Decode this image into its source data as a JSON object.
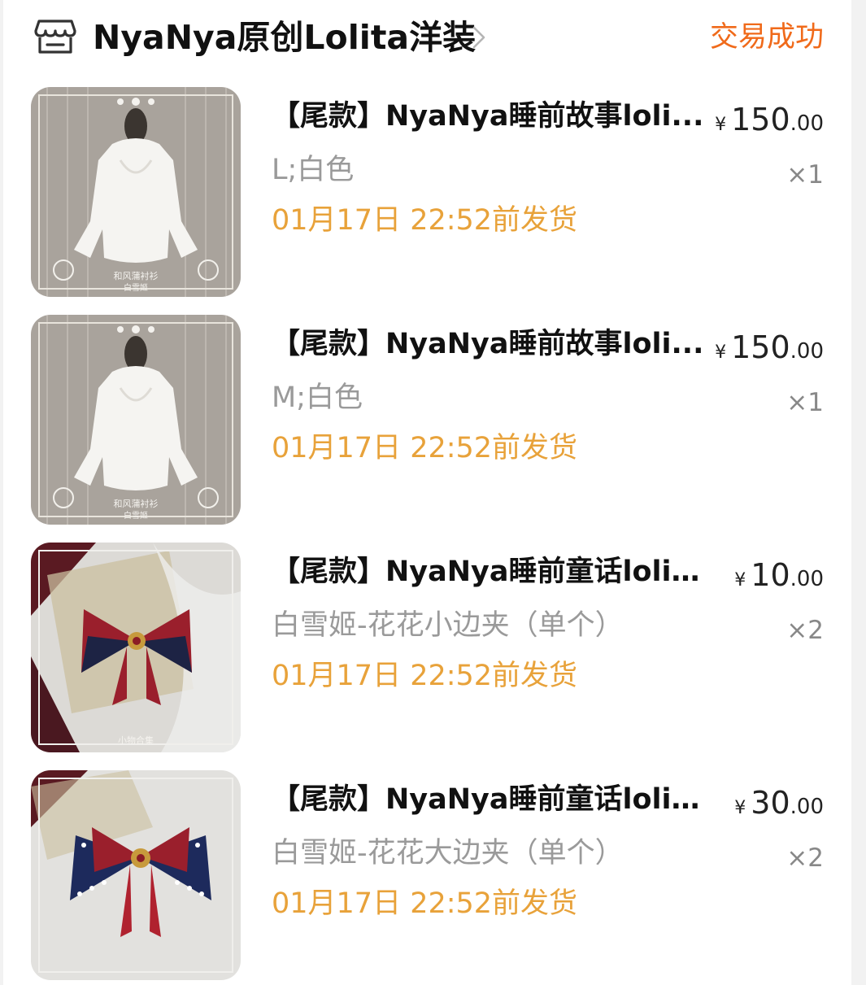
{
  "shop": {
    "name": "NyaNya原创Lolita洋装",
    "status": "交易成功",
    "icon": "shop-icon"
  },
  "colors": {
    "status": "#f06a1a",
    "ship": "#e8a23a",
    "sku": "#9a9a9a"
  },
  "items": [
    {
      "title": "【尾款】NyaNya睡前故事loli...",
      "price_currency": "¥",
      "price_int": "150",
      "price_dec": ".00",
      "sku": "L;白色",
      "qty": "×1",
      "ship": "01月17日 22:52前发货",
      "image_caption_1": "和风蒲衬衫",
      "image_caption_2": "白雪姬"
    },
    {
      "title": "【尾款】NyaNya睡前故事loli...",
      "price_currency": "¥",
      "price_int": "150",
      "price_dec": ".00",
      "sku": "M;白色",
      "qty": "×1",
      "ship": "01月17日 22:52前发货",
      "image_caption_1": "和风蒲衬衫",
      "image_caption_2": "白雪姬"
    },
    {
      "title": "【尾款】NyaNya睡前童话lolit...",
      "price_currency": "¥",
      "price_int": "10",
      "price_dec": ".00",
      "sku": "白雪姬-花花小边夹（单个）",
      "qty": "×2",
      "ship": "01月17日 22:52前发货",
      "image_caption_1": "小物合集"
    },
    {
      "title": "【尾款】NyaNya睡前童话lolit...",
      "price_currency": "¥",
      "price_int": "30",
      "price_dec": ".00",
      "sku": "白雪姬-花花大边夹（单个）",
      "qty": "×2",
      "ship": "01月17日 22:52前发货"
    }
  ]
}
